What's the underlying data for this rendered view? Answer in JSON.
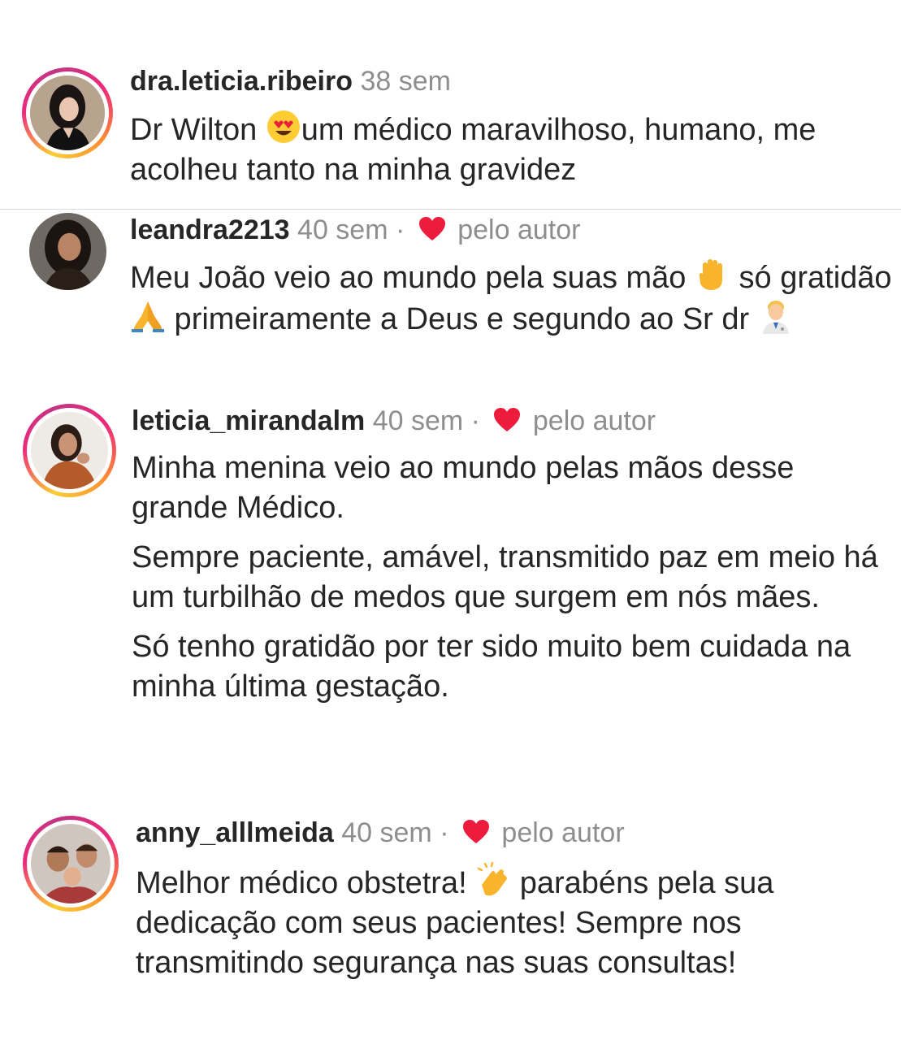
{
  "comments": [
    {
      "username": "dra.leticia.ribeiro",
      "time": "38 sem",
      "liked_by_author": false,
      "text_parts": [
        "Dr Wilton ",
        "um médico maravilhoso, humano, me acolheu tanto na minha gravidez"
      ],
      "emojis": [
        "heart-eyes-emoji"
      ]
    },
    {
      "username": "leandra2213",
      "time": "40 sem",
      "separator": "·",
      "liked_by_author": true,
      "liked_label": "pelo autor",
      "text_parts": [
        "Meu João veio ao mundo pela suas mão ",
        " só gratidão ",
        " primeiramente a Deus e segundo ao Sr dr "
      ],
      "emojis": [
        "raised-hand-emoji",
        "folded-hands-emoji",
        "health-worker-emoji"
      ]
    },
    {
      "username": "leticia_mirandalm",
      "time": "40 sem",
      "separator": "·",
      "liked_by_author": true,
      "liked_label": "pelo autor",
      "paragraphs": [
        "Minha menina veio ao mundo pelas mãos desse grande Médico.",
        "Sempre paciente, amável, transmitido paz em meio há um turbilhão de medos que surgem em nós mães.",
        "Só tenho gratidão por ter sido muito bem cuidada na minha última gestação."
      ]
    },
    {
      "username": "anny_alllmeida",
      "time": "40 sem",
      "separator": "·",
      "liked_by_author": true,
      "liked_label": "pelo autor",
      "text_parts": [
        "Melhor médico obstetra! ",
        " parabéns pela sua dedicação com seus pacientes! Sempre nos transmitindo segurança nas suas consultas!"
      ],
      "emojis": [
        "clapping-hands-emoji"
      ]
    }
  ],
  "colors": {
    "heart": "#ed1c3c",
    "muted": "#8e8e8e",
    "text": "#262626",
    "divider": "#dbdbdb"
  }
}
